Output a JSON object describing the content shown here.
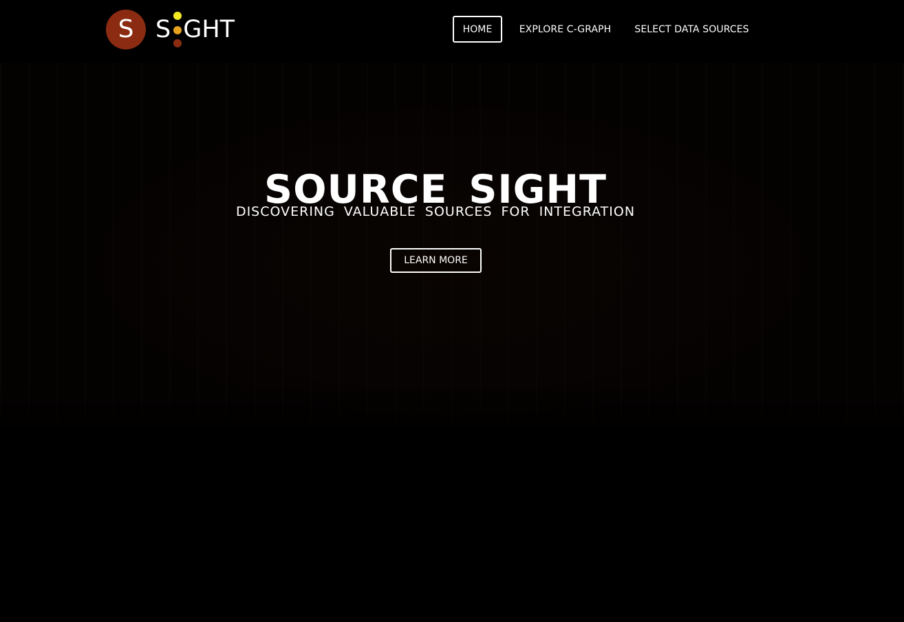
{
  "brand": {
    "logo_letter": "S",
    "logo_word_start": "S",
    "logo_word_end": "GHT",
    "logo_circle_color": "#8b2c12",
    "dot_colors": [
      "#f3ea24",
      "#e6a11f",
      "#8b2c12"
    ]
  },
  "nav": {
    "items": [
      {
        "label": "HOME",
        "active": true
      },
      {
        "label": "EXPLORE C-GRAPH",
        "active": false
      },
      {
        "label": "SELECT DATA SOURCES",
        "active": false
      }
    ]
  },
  "hero": {
    "title": "SOURCE SIGHT",
    "subtitle": "DISCOVERING VALUABLE SOURCES FOR INTEGRATION",
    "cta_label": "LEARN MORE"
  },
  "theme": {
    "background": "#000000",
    "text": "#ffffff"
  }
}
